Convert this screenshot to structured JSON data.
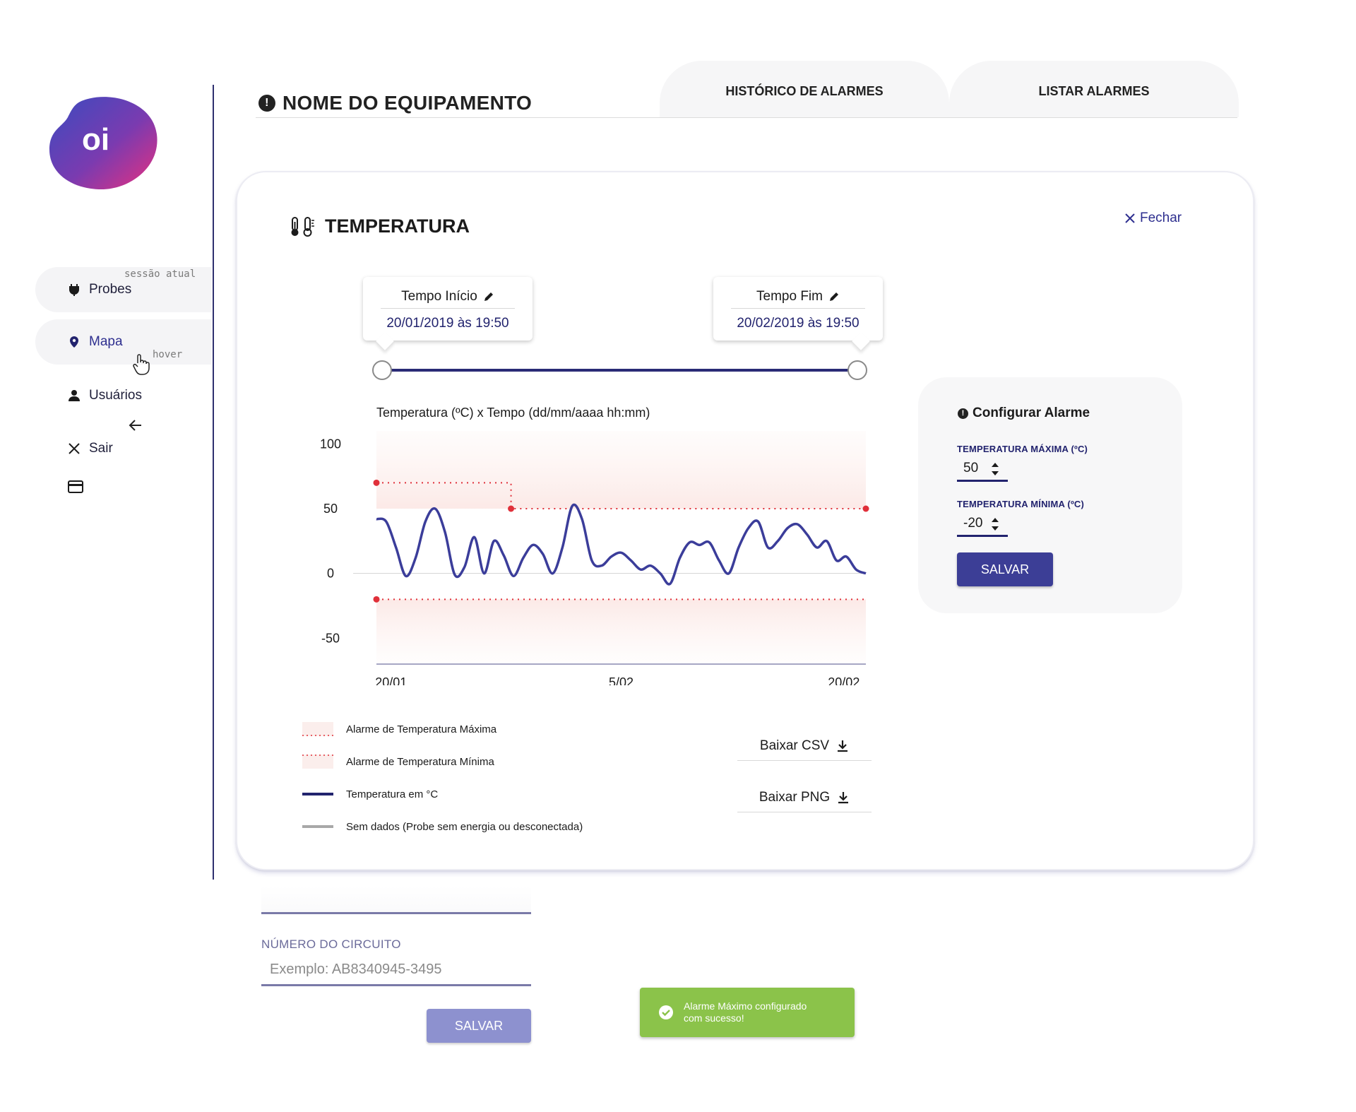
{
  "brand": {
    "logo_text": "oi",
    "accent": "#2e2f8f",
    "dark_navy": "#22236e"
  },
  "sidebar": {
    "items": [
      {
        "label": "Probes",
        "icon": "plug-icon",
        "state": "active"
      },
      {
        "label": "Mapa",
        "icon": "map-pin-icon",
        "state": "hover"
      },
      {
        "label": "Usuários",
        "icon": "user-icon",
        "state": "normal"
      },
      {
        "label": "Sair",
        "icon": "close-icon",
        "state": "normal"
      }
    ],
    "notes": {
      "current_session": "sessão atual",
      "hover": "hover"
    }
  },
  "header": {
    "title": "NOME DO EQUIPAMENTO",
    "tabs": [
      {
        "label": "HISTÓRICO DE ALARMES"
      },
      {
        "label": "LISTAR ALARMES"
      }
    ]
  },
  "panel": {
    "title": "TEMPERATURA",
    "close_label": "Fechar",
    "time_start": {
      "label": "Tempo Início",
      "value": "20/01/2019 às 19:50"
    },
    "time_end": {
      "label": "Tempo Fim",
      "value": "20/02/2019 às 19:50"
    },
    "chart_title": "Temperatura (ºC) x Tempo (dd/mm/aaaa hh:mm)",
    "legend": [
      {
        "label": "Alarme de Temperatura Máxima"
      },
      {
        "label": "Alarme de Temperatura Mínima"
      },
      {
        "label": "Temperatura em °C"
      },
      {
        "label": "Sem dados (Probe sem energia ou desconectada)"
      }
    ],
    "downloads": [
      {
        "label": "Baixar CSV"
      },
      {
        "label": "Baixar PNG"
      }
    ]
  },
  "alarm_config": {
    "title": "Configurar Alarme",
    "max_label": "TEMPERATURA MÁXIMA (ºC)",
    "max_value": "50",
    "min_label": "TEMPERATURA MÍNIMA (ºC)",
    "min_value": "-20",
    "save_label": "SALVAR"
  },
  "form": {
    "circuit_label": "NÚMERO DO CIRCUITO",
    "circuit_placeholder": "Exemplo: AB8340945-3495",
    "save_label": "SALVAR"
  },
  "toast": {
    "message": "Alarme Máximo configurado com sucesso!"
  },
  "chart_data": {
    "type": "line",
    "title": "Temperatura (ºC) x Tempo (dd/mm/aaaa hh:mm)",
    "x_ticks": [
      "20/01",
      "5/02",
      "20/02"
    ],
    "y_ticks": [
      100,
      50,
      0,
      -50
    ],
    "ylim": [
      -70,
      110
    ],
    "x": [
      0,
      0.02,
      0.04,
      0.06,
      0.08,
      0.1,
      0.12,
      0.14,
      0.16,
      0.18,
      0.2,
      0.22,
      0.24,
      0.26,
      0.28,
      0.3,
      0.32,
      0.34,
      0.36,
      0.38,
      0.4,
      0.42,
      0.44,
      0.46,
      0.48,
      0.5,
      0.52,
      0.54,
      0.56,
      0.58,
      0.6,
      0.62,
      0.64,
      0.66,
      0.68,
      0.7,
      0.72,
      0.74,
      0.76,
      0.78,
      0.8,
      0.82,
      0.84,
      0.86,
      0.88,
      0.9,
      0.92,
      0.94,
      0.96,
      0.98,
      1.0
    ],
    "series": [
      {
        "name": "Temperatura em °C",
        "color": "#3b3d9a",
        "values": [
          42,
          40,
          20,
          -2,
          12,
          40,
          50,
          32,
          -1,
          5,
          28,
          0,
          25,
          14,
          -2,
          12,
          22,
          15,
          0,
          20,
          52,
          42,
          10,
          6,
          13,
          16,
          10,
          3,
          6,
          0,
          -8,
          12,
          24,
          22,
          24,
          10,
          0,
          20,
          35,
          40,
          20,
          25,
          35,
          38,
          30,
          20,
          25,
          10,
          13,
          3,
          0
        ],
        "x_extent": [
          0,
          1
        ]
      },
      {
        "name": "Alarme de Temperatura Máxima",
        "color": "#e0303a",
        "style": "dotted",
        "points": [
          [
            0,
            70
          ],
          [
            0.275,
            70
          ],
          [
            0.275,
            50
          ],
          [
            1.0,
            50
          ]
        ]
      },
      {
        "name": "Alarme de Temperatura Mínima",
        "color": "#e0303a",
        "style": "dotted",
        "points": [
          [
            0,
            -20
          ],
          [
            1.0,
            -20
          ]
        ]
      }
    ],
    "grid": false
  }
}
